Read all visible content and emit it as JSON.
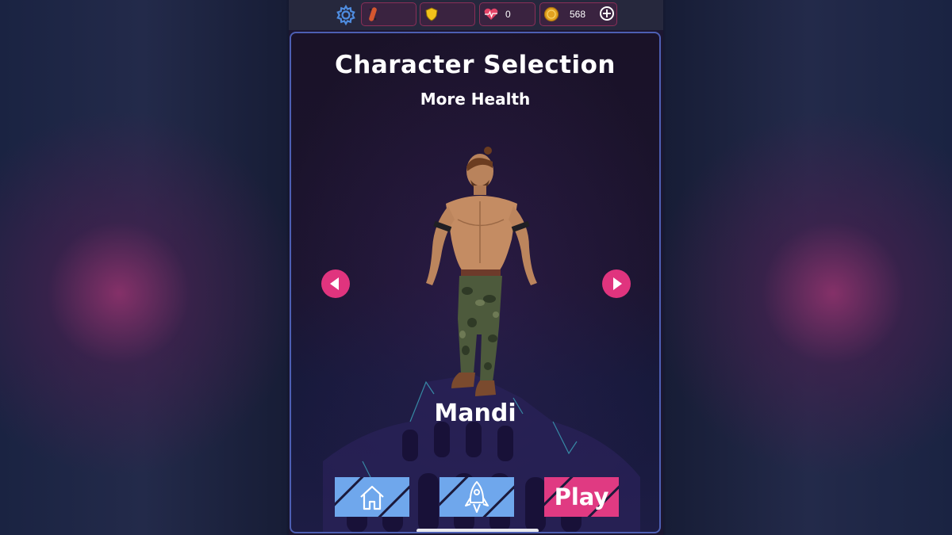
{
  "hud": {
    "settings_icon": "gear-icon",
    "skateboard_icon": "skateboard-icon",
    "shield_icon": "shield-icon",
    "health_icon": "heartbeat-icon",
    "health_value": "0",
    "coin_icon": "coin-icon",
    "coins_value": "568",
    "add_icon": "plus-icon"
  },
  "screen": {
    "title": "Character Selection",
    "subtitle": "More Health",
    "character_name": "Mandi",
    "prev_icon": "arrow-left-icon",
    "next_icon": "arrow-right-icon"
  },
  "buttons": {
    "home_icon": "home-icon",
    "rocket_icon": "rocket-icon",
    "play_label": "Play"
  },
  "colors": {
    "accent_pink": "#e03a82",
    "accent_blue": "#6fa7ec",
    "panel_border": "#4d5fb3"
  }
}
